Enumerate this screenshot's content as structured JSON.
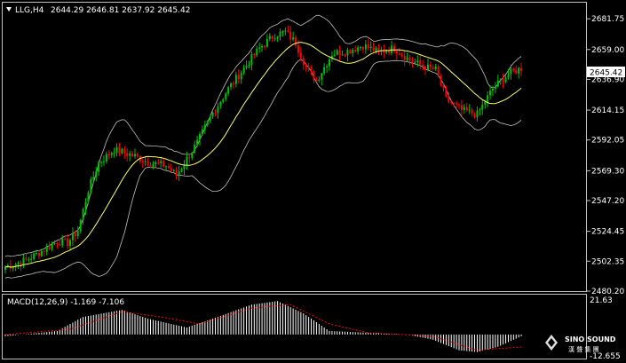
{
  "header": {
    "symbol": "LLG,H4",
    "ohlc": "2644.29 2646.81 2637.92 2645.42"
  },
  "macd": {
    "label": "MACD(12,26,9) -1.169 -7.106",
    "axis_top": "21.63",
    "axis_bottom": "-12.655"
  },
  "logo": {
    "name": "SINO SOUND",
    "sub": "漢 聲 集 團"
  },
  "colors": {
    "background": "#000000",
    "bull": "#00c000",
    "bear": "#ff0000",
    "ma": "#ffff66",
    "band": "#c0c0c0",
    "signal": "#ff0000",
    "histogram": "#ffffff"
  },
  "chart_data": {
    "type": "candlestick",
    "timeframe": "H4",
    "y_ticks": [
      "2681.75",
      "2659.00",
      "2636.90",
      "2614.15",
      "2592.05",
      "2569.30",
      "2547.20",
      "2524.45",
      "2502.35",
      "2480.20"
    ],
    "ylim": [
      2480.2,
      2693.0
    ],
    "current_price": "2645.42",
    "indicators": [
      "Bollinger Bands",
      "Moving Average",
      "MACD(12,26,9)"
    ],
    "close_path": [
      [
        0,
        2498
      ],
      [
        8,
        2503
      ],
      [
        16,
        2512
      ],
      [
        20,
        2517
      ],
      [
        24,
        2516
      ],
      [
        28,
        2525
      ],
      [
        32,
        2555
      ],
      [
        36,
        2575
      ],
      [
        42,
        2585
      ],
      [
        50,
        2580
      ],
      [
        56,
        2575
      ],
      [
        62,
        2573
      ],
      [
        66,
        2566
      ],
      [
        70,
        2578
      ],
      [
        74,
        2590
      ],
      [
        80,
        2612
      ],
      [
        86,
        2630
      ],
      [
        92,
        2645
      ],
      [
        98,
        2660
      ],
      [
        104,
        2670
      ],
      [
        108,
        2672
      ],
      [
        112,
        2664
      ],
      [
        116,
        2646
      ],
      [
        120,
        2636
      ],
      [
        126,
        2656
      ],
      [
        132,
        2658
      ],
      [
        138,
        2662
      ],
      [
        144,
        2657
      ],
      [
        150,
        2660
      ],
      [
        156,
        2651
      ],
      [
        162,
        2646
      ],
      [
        166,
        2644
      ],
      [
        170,
        2622
      ],
      [
        176,
        2614
      ],
      [
        182,
        2611
      ],
      [
        188,
        2630
      ],
      [
        194,
        2641
      ],
      [
        199,
        2645
      ]
    ],
    "macd_hist_path": [
      [
        0,
        -1
      ],
      [
        20,
        2
      ],
      [
        30,
        10
      ],
      [
        45,
        14
      ],
      [
        55,
        9
      ],
      [
        70,
        4
      ],
      [
        80,
        9
      ],
      [
        95,
        17
      ],
      [
        105,
        19
      ],
      [
        115,
        12
      ],
      [
        125,
        2
      ],
      [
        140,
        1
      ],
      [
        155,
        0
      ],
      [
        165,
        -3
      ],
      [
        175,
        -9
      ],
      [
        182,
        -10
      ],
      [
        190,
        -7
      ],
      [
        199,
        -1
      ]
    ],
    "macd_signal_path": [
      [
        0,
        0
      ],
      [
        25,
        3
      ],
      [
        45,
        13
      ],
      [
        60,
        10
      ],
      [
        75,
        6
      ],
      [
        95,
        15
      ],
      [
        110,
        17
      ],
      [
        125,
        6
      ],
      [
        140,
        1
      ],
      [
        165,
        -1
      ],
      [
        182,
        -9
      ],
      [
        190,
        -8
      ],
      [
        199,
        -7.1
      ]
    ],
    "macd_ylim": [
      -12.655,
      21.63
    ]
  }
}
